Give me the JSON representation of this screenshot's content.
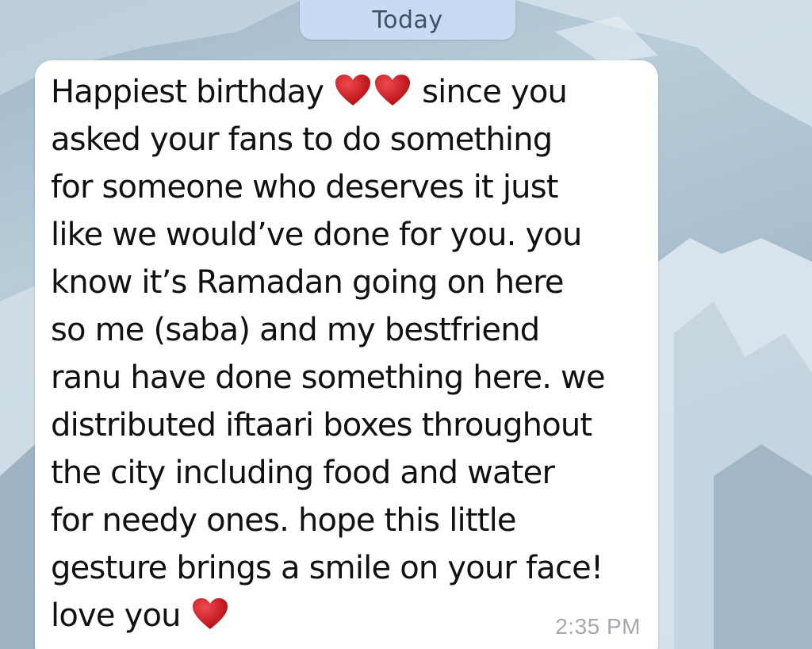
{
  "header": {
    "date_label": "Today"
  },
  "message": {
    "lines": [
      {
        "before": "Happiest birthday ",
        "after": " since you"
      },
      {
        "text": "asked your fans to do something"
      },
      {
        "text": "for someone who deserves it just"
      },
      {
        "text": "like we would’ve done for you. you"
      },
      {
        "text": "know it’s Ramadan going on here"
      },
      {
        "text": "so me (saba) and my bestfriend"
      },
      {
        "text": "ranu have done something here. we"
      },
      {
        "text": "distributed iftaari boxes throughout"
      },
      {
        "text": "the city including food and water"
      },
      {
        "text": "for needy ones. hope this little"
      },
      {
        "text": "gesture brings a smile on your face!"
      },
      {
        "before": "love you "
      }
    ],
    "emojis": [
      "red-heart",
      "red-heart",
      "red-heart"
    ],
    "time": "2:35 PM"
  },
  "colors": {
    "bubble": "#ffffff",
    "date_pill": "#c7dcf2",
    "date_text": "#3e5266",
    "heart": "#c8161d",
    "timestamp": "#a3a9ae"
  }
}
